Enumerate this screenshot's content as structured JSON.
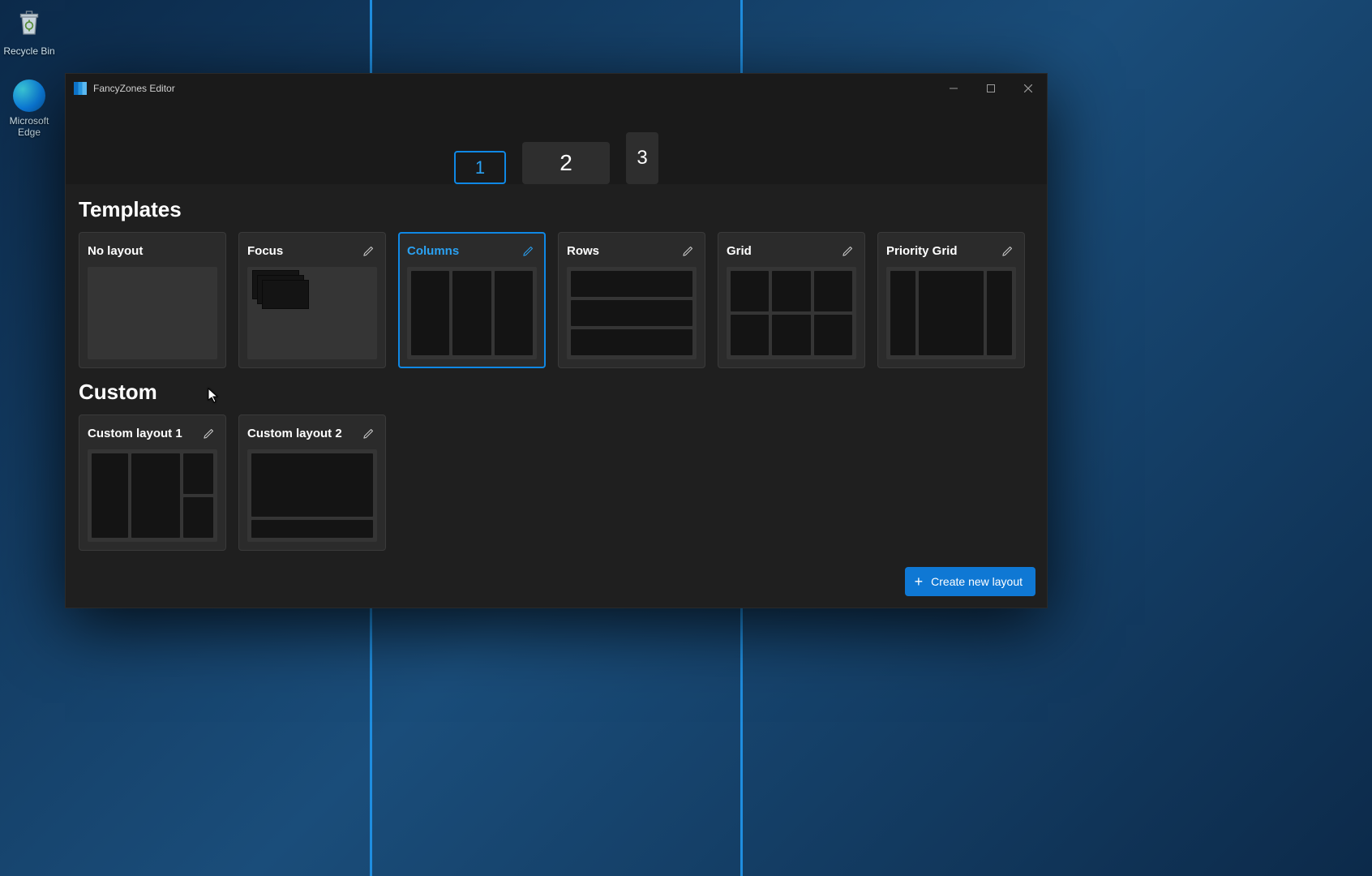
{
  "desktop": {
    "icons": {
      "recycle_bin": "Recycle Bin",
      "edge": "Microsoft Edge"
    }
  },
  "window": {
    "title": "FancyZones Editor"
  },
  "monitors": {
    "tabs": [
      "1",
      "2",
      "3"
    ],
    "selected_index": 0
  },
  "sections": {
    "templates_title": "Templates",
    "custom_title": "Custom"
  },
  "templates": [
    {
      "label": "No layout",
      "editable": false,
      "selected": false
    },
    {
      "label": "Focus",
      "editable": true,
      "selected": false
    },
    {
      "label": "Columns",
      "editable": true,
      "selected": true
    },
    {
      "label": "Rows",
      "editable": true,
      "selected": false
    },
    {
      "label": "Grid",
      "editable": true,
      "selected": false
    },
    {
      "label": "Priority Grid",
      "editable": true,
      "selected": false
    }
  ],
  "custom_layouts": [
    {
      "label": "Custom layout 1"
    },
    {
      "label": "Custom layout 2"
    }
  ],
  "actions": {
    "create_new_layout": "Create new layout"
  },
  "colors": {
    "accent": "#0f88e5",
    "button_primary": "#0f78d4"
  }
}
